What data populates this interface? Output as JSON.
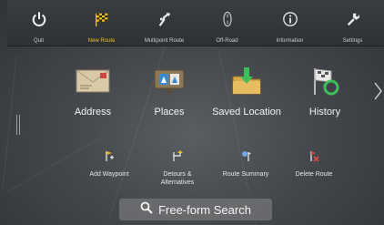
{
  "topbar": {
    "items": [
      {
        "label": "Quit",
        "icon": "power-icon"
      },
      {
        "label": "New Route",
        "icon": "checkered-flag-icon",
        "active": true
      },
      {
        "label": "Multipoint Route",
        "icon": "route-arrow-icon"
      },
      {
        "label": "Off-Road",
        "icon": "off-road-icon"
      },
      {
        "label": "Information",
        "icon": "info-icon"
      },
      {
        "label": "Settings",
        "icon": "wrench-icon"
      }
    ]
  },
  "main": {
    "items": [
      {
        "label": "Address",
        "icon": "envelope-icon"
      },
      {
        "label": "Places",
        "icon": "signboard-icon"
      },
      {
        "label": "Saved Location",
        "icon": "folder-download-icon"
      },
      {
        "label": "History",
        "icon": "history-flag-icon"
      }
    ]
  },
  "secondary": {
    "items": [
      {
        "label": "Add Waypoint",
        "icon": "add-waypoint-icon"
      },
      {
        "label": "Detours &\nAlternatives",
        "icon": "detours-icon"
      },
      {
        "label": "Route Summary",
        "icon": "route-summary-icon"
      },
      {
        "label": "Delete Route",
        "icon": "delete-route-icon"
      }
    ]
  },
  "search": {
    "label": "Free-form Search",
    "icon": "search-icon"
  },
  "colors": {
    "accent": "#f0c020",
    "text": "#f2f2f2",
    "background": "#44484c"
  }
}
